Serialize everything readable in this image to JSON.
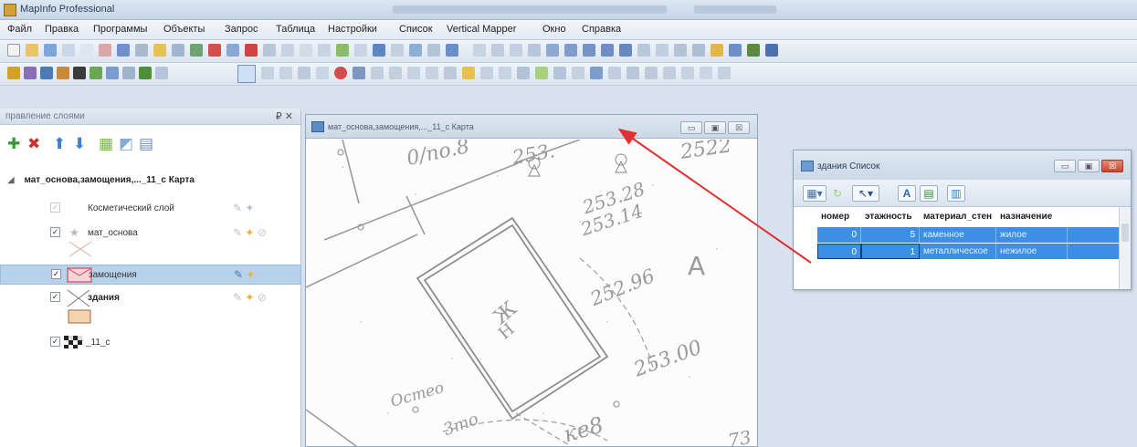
{
  "app": {
    "title": "MapInfo Professional"
  },
  "menu": {
    "items": [
      "Файл",
      "Правка",
      "Программы",
      "Объекты",
      "Запрос",
      "Таблица",
      "Настройки",
      "Список",
      "Vertical Mapper",
      "Окно",
      "Справка"
    ]
  },
  "layer_panel": {
    "title": "правление слоями",
    "pin_close": "₽ ✕",
    "map_name": "мат_основа,замощения,..._11_с Карта",
    "layers": [
      {
        "label": "Косметический слой",
        "checked": "✓",
        "selected": false,
        "bold": false
      },
      {
        "label": "мат_основа",
        "checked": "✓",
        "selected": false,
        "bold": false
      },
      {
        "label": "замощения",
        "checked": "✓",
        "selected": true,
        "bold": false
      },
      {
        "label": "здания",
        "checked": "✓",
        "selected": false,
        "bold": true
      },
      {
        "label": "_11_с",
        "checked": "✓",
        "selected": false,
        "bold": false
      }
    ]
  },
  "map_window": {
    "title": "мат_основа,замощения,..._11_с Карта",
    "btn_min": "▭",
    "btn_max": "▣",
    "btn_close": "☒",
    "labels": {
      "l1": "0/no.8",
      "l2": "253.",
      "l3": "2522",
      "l4": "253.28",
      "l5": "253.14",
      "l6": "A",
      "l7": "252.96",
      "l8": "253.00",
      "l9": "Остео",
      "l10": "3mo",
      "l11": "ке8",
      "l12": "73",
      "l13": "Ж",
      "l14": "Н"
    }
  },
  "browser_window": {
    "title": "здания Список",
    "columns": [
      "номер",
      "этажность",
      "материал_стен",
      "назначение"
    ],
    "rows": [
      [
        "0",
        "5",
        "каменное",
        "жилое"
      ],
      [
        "0",
        "1",
        "металлическое",
        "нежилое"
      ]
    ]
  },
  "colors": {
    "selection_blue": "#3d8fe6",
    "arrow_red": "#e03030",
    "window_frame": "#8fa6c1"
  }
}
